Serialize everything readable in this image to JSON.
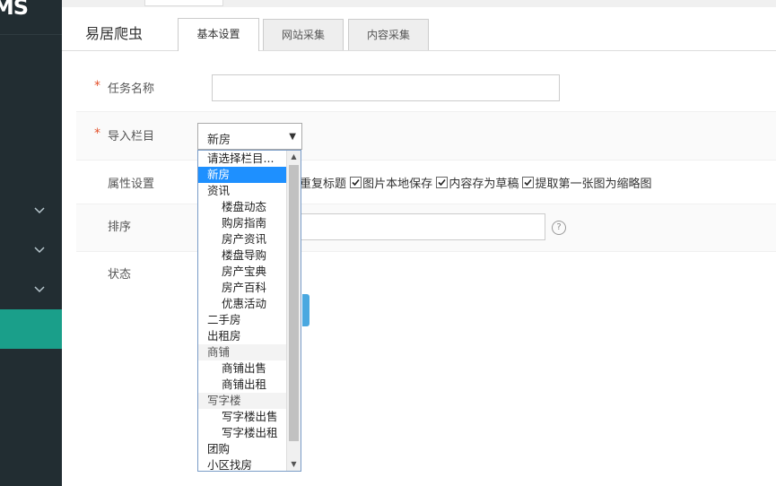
{
  "app": {
    "logo_text": "MS"
  },
  "panel": {
    "title": "易居爬虫",
    "tabs": [
      {
        "label": "基本设置",
        "active": true
      },
      {
        "label": "网站采集",
        "active": false
      },
      {
        "label": "内容采集",
        "active": false
      }
    ]
  },
  "form": {
    "task_name": {
      "label": "任务名称",
      "required_mark": "*",
      "value": ""
    },
    "import_column": {
      "label": "导入栏目",
      "required_mark": "*",
      "selected": "新房"
    },
    "attributes": {
      "label": "属性设置",
      "options_visible": [
        {
          "label": "重复标题",
          "checked": true
        },
        {
          "label": "图片本地保存",
          "checked": true
        },
        {
          "label": "内容存为草稿",
          "checked": true
        },
        {
          "label": "提取第一张图为缩略图",
          "checked": true
        }
      ]
    },
    "sort": {
      "label": "排序",
      "value": "",
      "help_symbol": "?"
    },
    "status": {
      "label": "状态"
    }
  },
  "dropdown": {
    "items": [
      {
        "label": "请选择栏目...",
        "kind": "placeholder"
      },
      {
        "label": "新房",
        "kind": "selected"
      },
      {
        "label": "资讯",
        "kind": "top"
      },
      {
        "label": "楼盘动态",
        "kind": "sub"
      },
      {
        "label": "购房指南",
        "kind": "sub"
      },
      {
        "label": "房产资讯",
        "kind": "sub"
      },
      {
        "label": "楼盘导购",
        "kind": "sub"
      },
      {
        "label": "房产宝典",
        "kind": "sub"
      },
      {
        "label": "房产百科",
        "kind": "sub"
      },
      {
        "label": "优惠活动",
        "kind": "sub"
      },
      {
        "label": "二手房",
        "kind": "top"
      },
      {
        "label": "出租房",
        "kind": "top"
      },
      {
        "label": "商铺",
        "kind": "group"
      },
      {
        "label": "商铺出售",
        "kind": "sub"
      },
      {
        "label": "商铺出租",
        "kind": "sub"
      },
      {
        "label": "写字楼",
        "kind": "group"
      },
      {
        "label": "写字楼出售",
        "kind": "sub"
      },
      {
        "label": "写字楼出租",
        "kind": "sub"
      },
      {
        "label": "团购",
        "kind": "top"
      },
      {
        "label": "小区找房",
        "kind": "top"
      }
    ]
  },
  "colors": {
    "sidebar_bg": "#222d32",
    "sidebar_active": "#1a9f8a",
    "required": "#e4512b",
    "selected_option": "#1e90ff"
  }
}
